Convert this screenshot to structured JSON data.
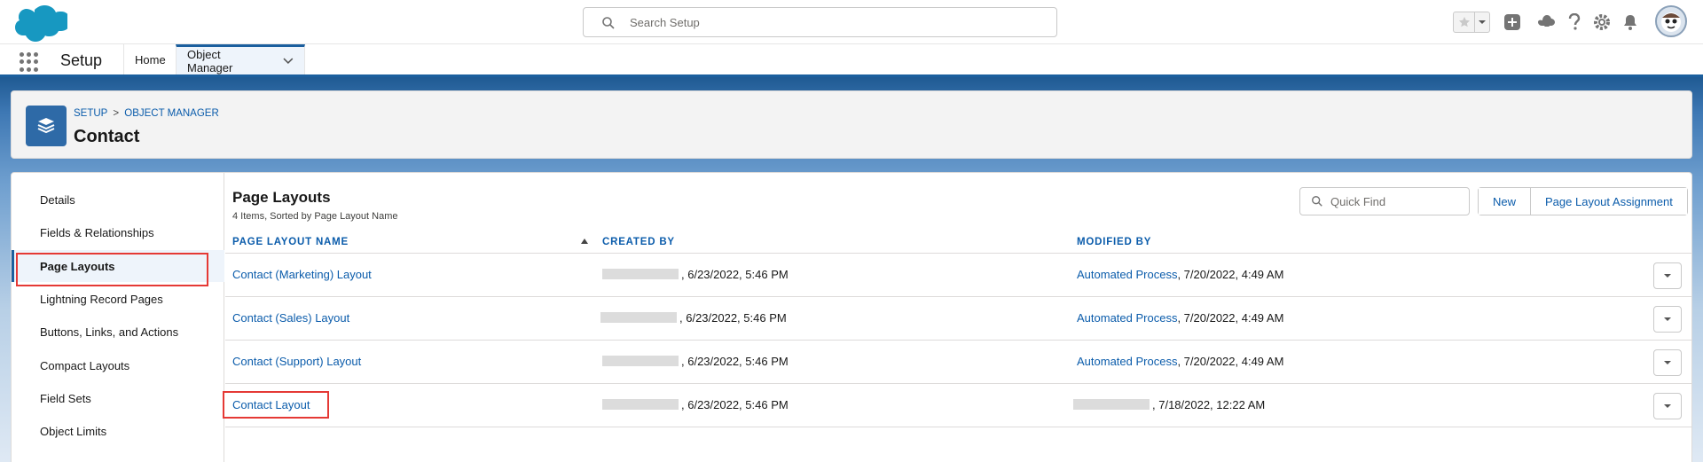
{
  "header": {
    "search_placeholder": "Search Setup"
  },
  "context": {
    "app_name": "Setup",
    "tabs": [
      {
        "label": "Home"
      },
      {
        "label": "Object Manager"
      }
    ]
  },
  "object_header": {
    "breadcrumb": [
      "SETUP",
      "OBJECT MANAGER"
    ],
    "breadcrumb_sep": ">",
    "title": "Contact"
  },
  "sidebar": {
    "items": [
      {
        "label": "Details"
      },
      {
        "label": "Fields & Relationships"
      },
      {
        "label": "Page Layouts"
      },
      {
        "label": "Lightning Record Pages"
      },
      {
        "label": "Buttons, Links, and Actions"
      },
      {
        "label": "Compact Layouts"
      },
      {
        "label": "Field Sets"
      },
      {
        "label": "Object Limits"
      }
    ]
  },
  "content": {
    "title": "Page Layouts",
    "subtitle": "4 Items, Sorted by Page Layout Name",
    "quick_find_placeholder": "Quick Find",
    "buttons": {
      "new": "New",
      "assignment": "Page Layout Assignment"
    },
    "columns": [
      "PAGE LAYOUT NAME",
      "CREATED BY",
      "MODIFIED BY"
    ],
    "rows": [
      {
        "name": "Contact (Marketing) Layout",
        "created": ", 6/23/2022, 5:46 PM",
        "modified_by": "Automated Process",
        "modified": ", 7/20/2022, 4:49 AM"
      },
      {
        "name": "Contact (Sales) Layout",
        "created": ", 6/23/2022, 5:46 PM",
        "modified_by": "Automated Process",
        "modified": ", 7/20/2022, 4:49 AM"
      },
      {
        "name": "Contact (Support) Layout",
        "created": ", 6/23/2022, 5:46 PM",
        "modified_by": "Automated Process",
        "modified": ", 7/20/2022, 4:49 AM"
      },
      {
        "name": "Contact Layout",
        "created": ", 6/23/2022, 5:46 PM",
        "modified_by": "",
        "modified": ", 7/18/2022, 12:22 AM"
      }
    ]
  },
  "colors": {
    "brand_blue": "#1b5f9e",
    "link_blue": "#0b5cab",
    "highlight_red": "#e53935"
  },
  "icons": [
    "salesforce-cloud-logo",
    "search-icon",
    "star-icon",
    "chevron-down-icon",
    "plus-icon",
    "trailhead-icon",
    "help-icon",
    "gear-icon",
    "bell-icon",
    "avatar",
    "app-launcher-icon",
    "layers-icon",
    "sort-up-icon"
  ]
}
